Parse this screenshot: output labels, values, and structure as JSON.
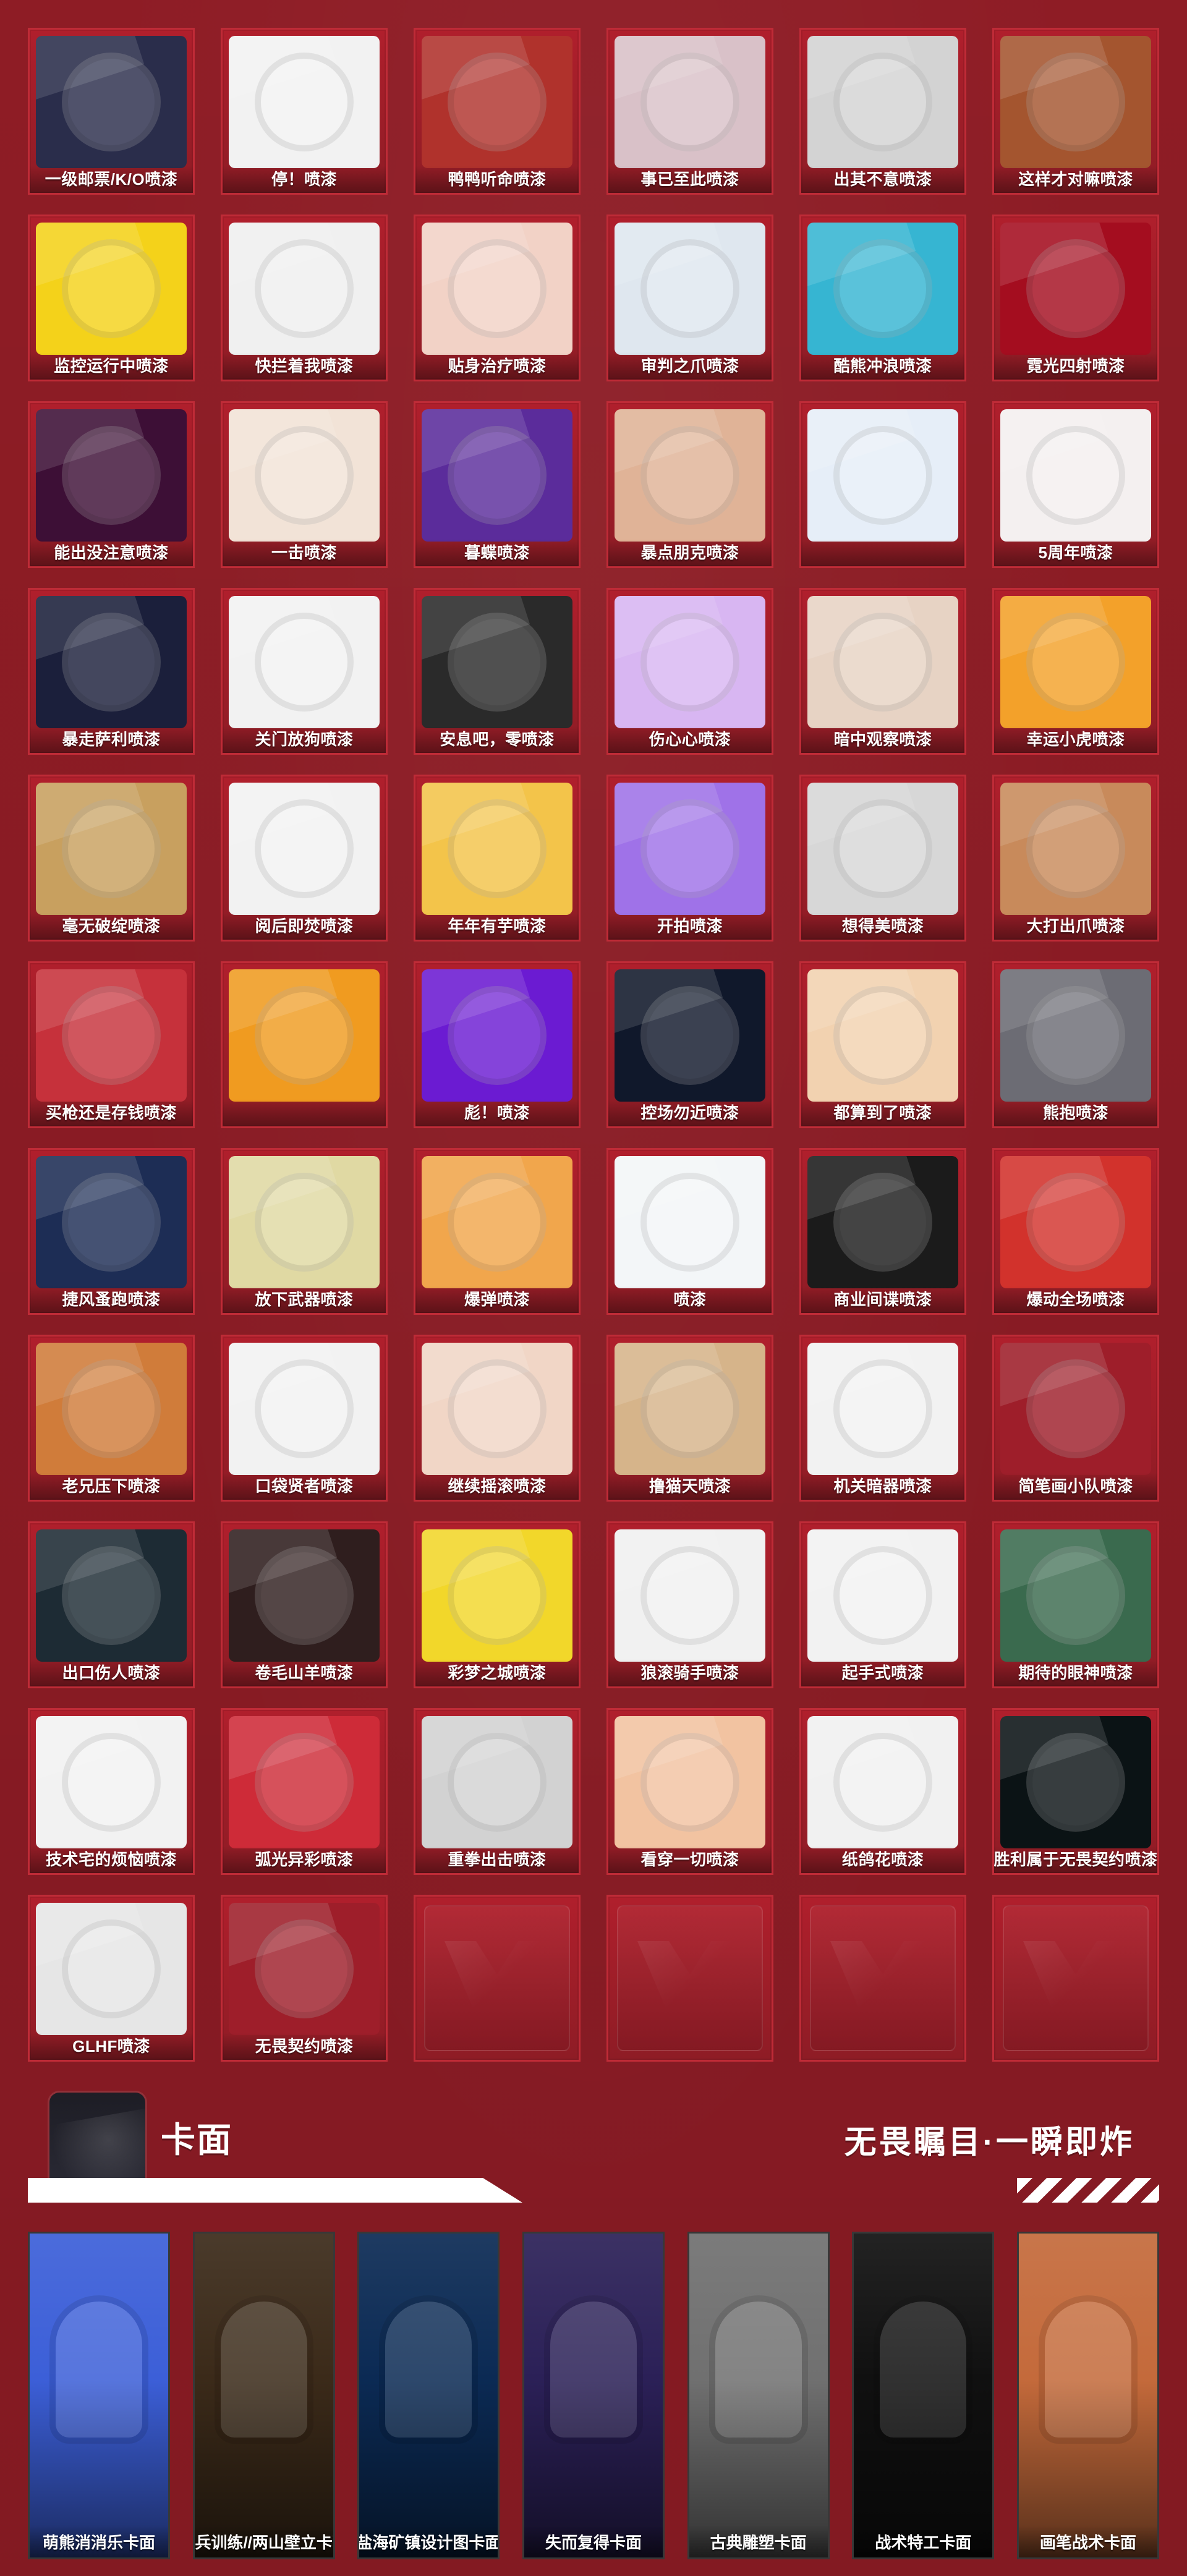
{
  "sprays": [
    {
      "label": "一级邮票/K/O喷漆",
      "color": "#2a2d4b"
    },
    {
      "label": "停！喷漆",
      "color": "#f2f2f2"
    },
    {
      "label": "鸭鸭听命喷漆",
      "color": "#b0322c"
    },
    {
      "label": "事已至此喷漆",
      "color": "#d9c1c8"
    },
    {
      "label": "出其不意喷漆",
      "color": "#d3d3d3"
    },
    {
      "label": "这样才对嘛喷漆",
      "color": "#a4552f"
    },
    {
      "label": "监控运行中喷漆",
      "color": "#f4d21a"
    },
    {
      "label": "快拦着我喷漆",
      "color": "#f0f0f0"
    },
    {
      "label": "贴身治疗喷漆",
      "color": "#f2d2c6"
    },
    {
      "label": "审判之爪喷漆",
      "color": "#dfe7ef"
    },
    {
      "label": "酷熊冲浪喷漆",
      "color": "#36b5d2"
    },
    {
      "label": "霓光四射喷漆",
      "color": "#a40d1f"
    },
    {
      "label": "能出没注意喷漆",
      "color": "#3d0f36"
    },
    {
      "label": "一击喷漆",
      "color": "#f2e3d7"
    },
    {
      "label": "暮蝶喷漆",
      "color": "#5b2c9b"
    },
    {
      "label": "暴点朋克喷漆",
      "color": "#e0b397"
    },
    {
      "label": "",
      "color": "#e6eef8"
    },
    {
      "label": "5周年喷漆",
      "color": "#f4f0f0"
    },
    {
      "label": "暴走萨利喷漆",
      "color": "#1b1f3b"
    },
    {
      "label": "关门放狗喷漆",
      "color": "#f2f2f2"
    },
    {
      "label": "安息吧，零喷漆",
      "color": "#2a2a2a"
    },
    {
      "label": "伤心心喷漆",
      "color": "#d8b6f2"
    },
    {
      "label": "暗中观察喷漆",
      "color": "#e7d3c4"
    },
    {
      "label": "幸运小虎喷漆",
      "color": "#f3a12a"
    },
    {
      "label": "毫无破绽喷漆",
      "color": "#c8a05f"
    },
    {
      "label": "阅后即焚喷漆",
      "color": "#f2f2f2"
    },
    {
      "label": "年年有芋喷漆",
      "color": "#f3c44a"
    },
    {
      "label": "开拍喷漆",
      "color": "#9f72e8"
    },
    {
      "label": "想得美喷漆",
      "color": "#d7d7d7"
    },
    {
      "label": "大打出爪喷漆",
      "color": "#c88a5b"
    },
    {
      "label": "买枪还是存钱喷漆",
      "color": "#c6313b"
    },
    {
      "label": "",
      "color": "#f09b20"
    },
    {
      "label": "彪！喷漆",
      "color": "#6b1bd2"
    },
    {
      "label": "控场勿近喷漆",
      "color": "#10182b"
    },
    {
      "label": "都算到了喷漆",
      "color": "#f2d2b0"
    },
    {
      "label": "熊抱喷漆",
      "color": "#6c6c74"
    },
    {
      "label": "捷风蚤跑喷漆",
      "color": "#1d2d55"
    },
    {
      "label": "放下武器喷漆",
      "color": "#e0d9a3"
    },
    {
      "label": "爆弹喷漆",
      "color": "#f1a64c"
    },
    {
      "label": "喷漆",
      "color": "#f3f6f8"
    },
    {
      "label": "商业间谍喷漆",
      "color": "#1b1b1b"
    },
    {
      "label": "爆动全场喷漆",
      "color": "#d2322c"
    },
    {
      "label": "老兄压下喷漆",
      "color": "#d07c3a"
    },
    {
      "label": "口袋贤者喷漆",
      "color": "#f2f2f2"
    },
    {
      "label": "继续摇滚喷漆",
      "color": "#f1d6c6"
    },
    {
      "label": "撸猫天喷漆",
      "color": "#d6b48a"
    },
    {
      "label": "机关暗器喷漆",
      "color": "#f2f2f2"
    },
    {
      "label": "简笔画小队喷漆",
      "color": "#9e1e2a"
    },
    {
      "label": "出口伤人喷漆",
      "color": "#1d2b34"
    },
    {
      "label": "卷毛山羊喷漆",
      "color": "#2f1e1e"
    },
    {
      "label": "彩梦之城喷漆",
      "color": "#f2d72a"
    },
    {
      "label": "狼滚骑手喷漆",
      "color": "#f1f1f1"
    },
    {
      "label": "起手式喷漆",
      "color": "#f2f2f2"
    },
    {
      "label": "期待的眼神喷漆",
      "color": "#3a6a4e"
    },
    {
      "label": "技术宅的烦恼喷漆",
      "color": "#f2f2f2"
    },
    {
      "label": "弧光异彩喷漆",
      "color": "#ce2b38"
    },
    {
      "label": "重拳出击喷漆",
      "color": "#d2d2d2"
    },
    {
      "label": "看穿一切喷漆",
      "color": "#f2c3a1"
    },
    {
      "label": "纸鸽花喷漆",
      "color": "#f1f1f1"
    },
    {
      "label": "胜利属于无畏契约喷漆",
      "color": "#0b1315"
    },
    {
      "label": "GLHF喷漆",
      "color": "#e6e6e6"
    },
    {
      "label": "无畏契约喷漆",
      "color": "#9e1e2a"
    },
    {
      "label": "",
      "color": "",
      "empty": true
    },
    {
      "label": "",
      "color": "",
      "empty": true
    },
    {
      "label": "",
      "color": "",
      "empty": true
    },
    {
      "label": "",
      "color": "",
      "empty": true
    }
  ],
  "section": {
    "title": "卡面",
    "motto": "无畏瞩目·一瞬即炸"
  },
  "cards": [
    {
      "label": "萌熊消消乐卡面",
      "color": "#3c5fd8"
    },
    {
      "label": "新兵训练//两山壁立卡面",
      "color": "#3b2a19"
    },
    {
      "label": "盐海矿镇设计图卡面",
      "color": "#0b2a54"
    },
    {
      "label": "失而复得卡面",
      "color": "#2b2057"
    },
    {
      "label": "古典雕塑卡面",
      "color": "#707070"
    },
    {
      "label": "战术特工卡面",
      "color": "#101010"
    },
    {
      "label": "画笔战术卡面",
      "color": "#c46a3b"
    }
  ]
}
